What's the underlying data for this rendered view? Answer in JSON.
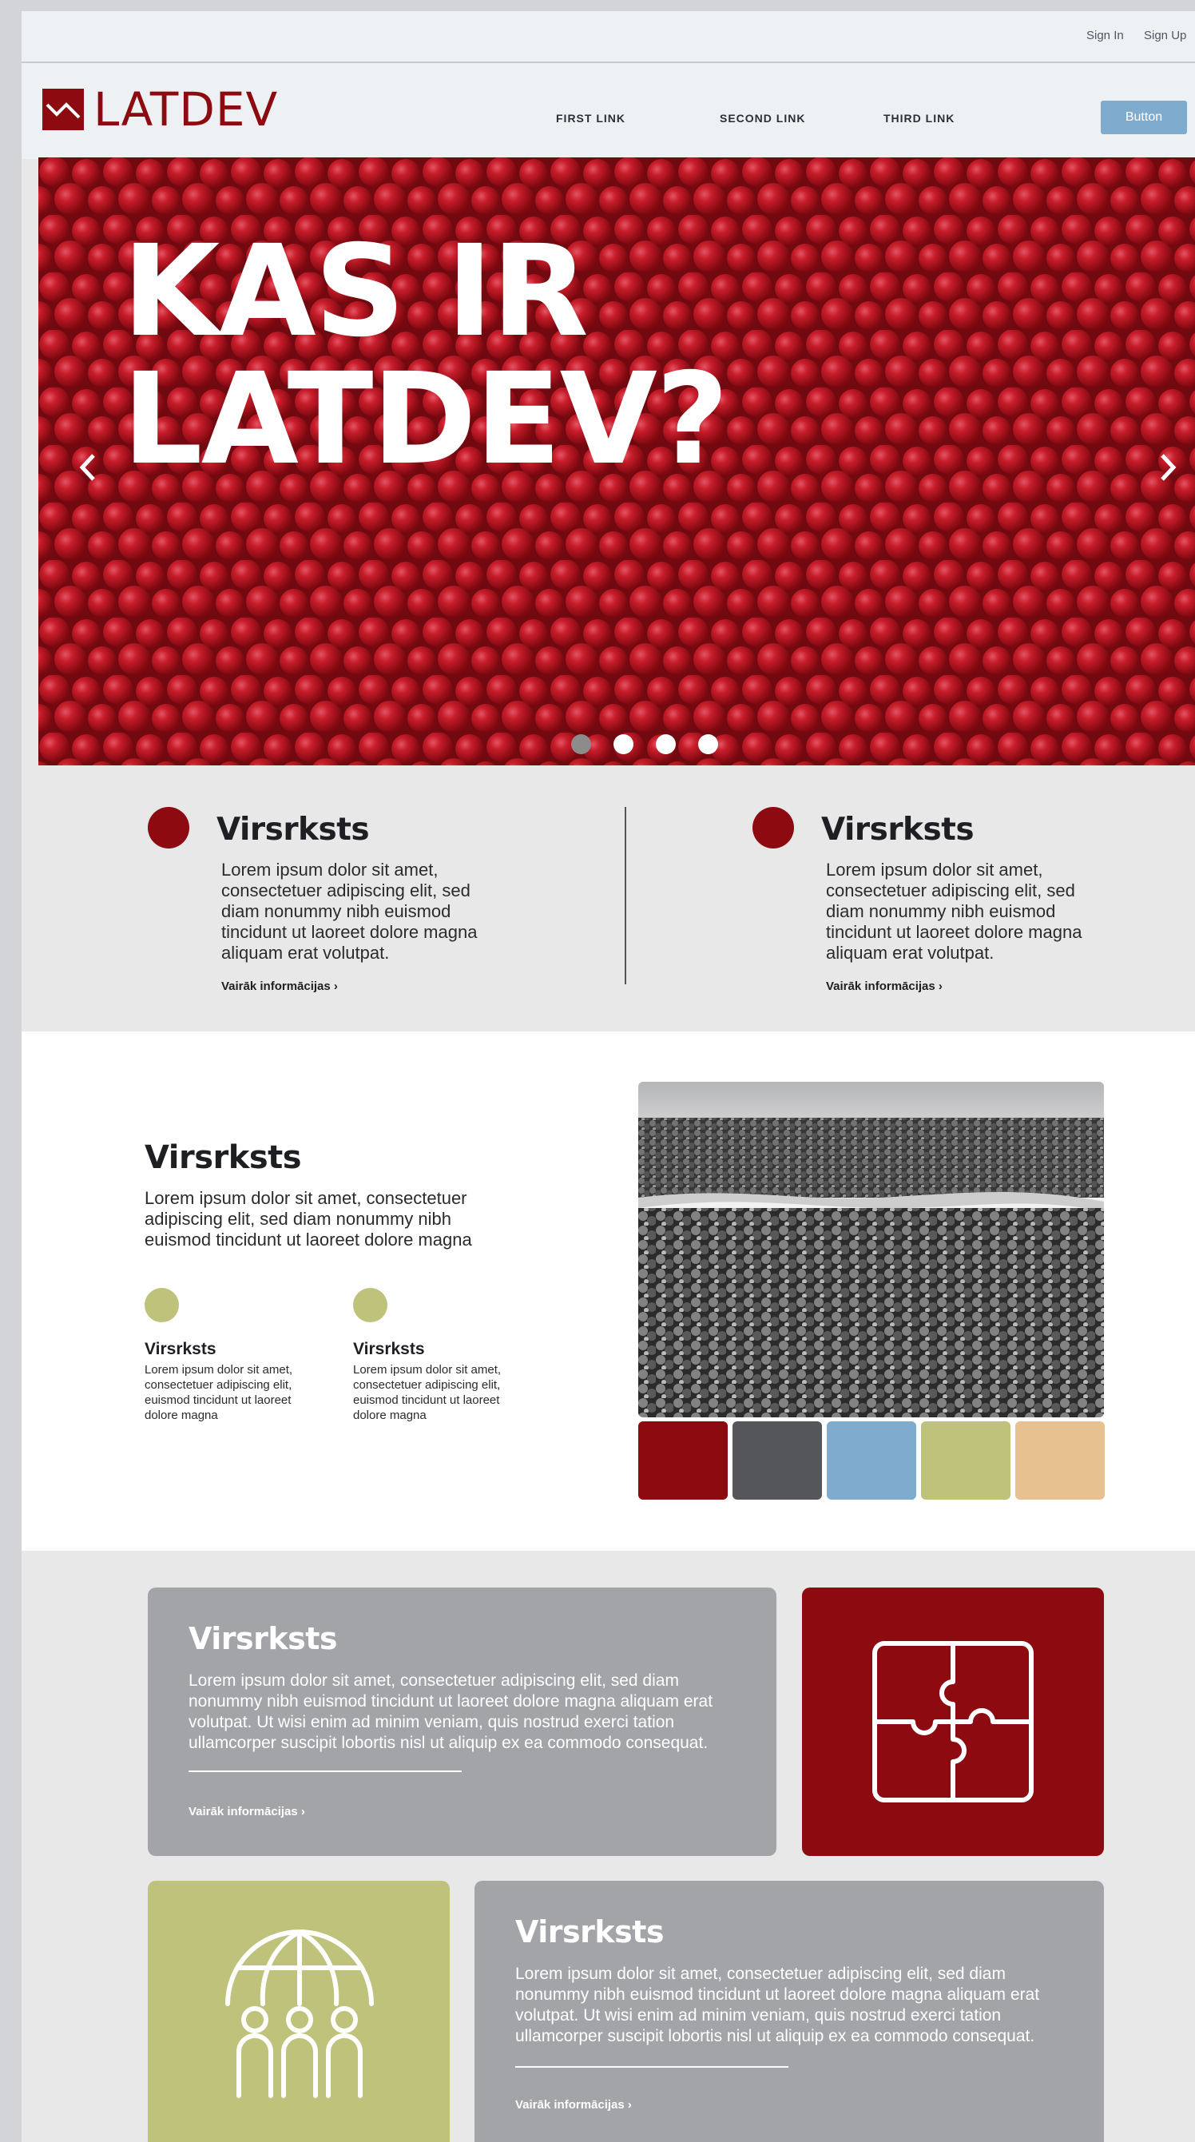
{
  "topbar": {
    "sign_in": "Sign In",
    "sign_up": "Sign Up"
  },
  "header": {
    "logo_text": "LATDEV",
    "nav": [
      "FIRST LINK",
      "SECOND LINK",
      "THIRD LINK"
    ],
    "button_label": "Button"
  },
  "hero": {
    "title": "KAS IR\nLATDEV?",
    "slides_count": 4,
    "active_slide": 1
  },
  "features": [
    {
      "title": "Virsrksts",
      "text": "Lorem ipsum dolor sit amet, consectetuer adipiscing elit, sed diam nonummy nibh euismod tincidunt ut laoreet dolore magna aliquam erat volutpat.",
      "more": "Vairāk informācijas"
    },
    {
      "title": "Virsrksts",
      "text": "Lorem ipsum dolor sit amet, consectetuer adipiscing elit, sed diam nonummy nibh euismod tincidunt ut laoreet dolore magna aliquam erat volutpat.",
      "more": "Vairāk informācijas"
    }
  ],
  "section2": {
    "title": "Virsrksts",
    "lead": "Lorem ipsum dolor sit amet, consectetuer adipiscing elit, sed diam nonummy nibh euismod tincidunt ut laoreet dolore magna",
    "items": [
      {
        "title": "Virsrksts",
        "text": "Lorem ipsum dolor sit amet, consectetuer adipiscing elit, euismod tincidunt ut laoreet dolore magna"
      },
      {
        "title": "Virsrksts",
        "text": "Lorem ipsum dolor sit amet, consectetuer adipiscing elit, euismod tincidunt ut laoreet dolore magna"
      }
    ],
    "swatches": [
      "#8c0a10",
      "#555659",
      "#7facce",
      "#bfc27a",
      "#e8c190"
    ]
  },
  "cards": [
    {
      "title": "Virsrksts",
      "text": "Lorem ipsum dolor sit amet, consectetuer adipiscing elit, sed diam nonummy nibh euismod tincidunt ut laoreet dolore magna aliquam erat volutpat. Ut wisi enim ad minim veniam, quis nostrud exerci tation ullamcorper suscipit lobortis nisl ut aliquip ex ea commodo consequat.",
      "more": "Vairāk informācijas",
      "icon": "puzzle-icon"
    },
    {
      "title": "Virsrksts",
      "text": "Lorem ipsum dolor sit amet, consectetuer adipiscing elit, sed diam nonummy nibh euismod tincidunt ut laoreet dolore magna aliquam erat volutpat. Ut wisi enim ad minim veniam, quis nostrud exerci tation ullamcorper suscipit lobortis nisl ut aliquip ex ea commodo consequat.",
      "more": "Vairāk informācijas",
      "icon": "global-team-icon"
    }
  ],
  "colors": {
    "brand_red": "#8c0a10",
    "accent_blue": "#7facce",
    "accent_olive": "#bfc27a",
    "card_grey": "#a3a4a8"
  }
}
